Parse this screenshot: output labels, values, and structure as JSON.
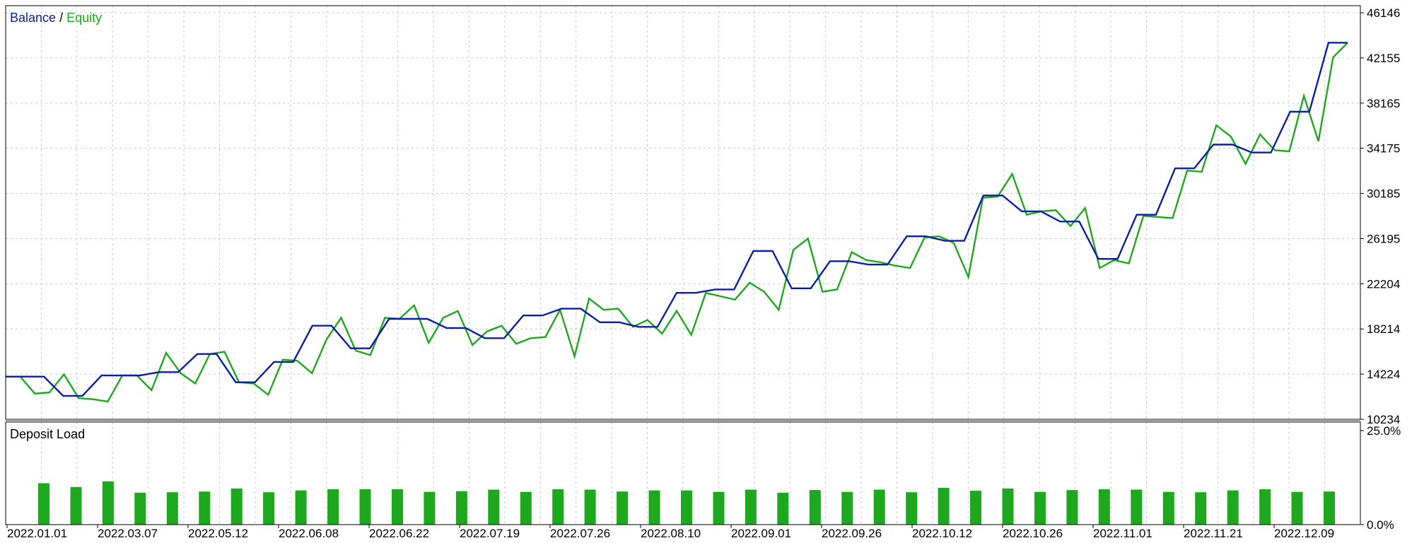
{
  "colors": {
    "balance": "#0b1fa6",
    "equity": "#1ea81e",
    "bars": "#1ea81e",
    "grid": "#c8c8c8",
    "frame": "#000000"
  },
  "legend": {
    "balance": "Balance",
    "separator": " / ",
    "equity": "Equity"
  },
  "chart_data": [
    {
      "type": "line",
      "title": "",
      "ylim": [
        10234,
        46146
      ],
      "yticks": [
        "46146",
        "42155",
        "38165",
        "34175",
        "30185",
        "26195",
        "22204",
        "18214",
        "14224",
        "10234"
      ],
      "grid": true,
      "legend_position": "top-left",
      "series": [
        {
          "name": "Balance",
          "values": [
            14000,
            14000,
            14000,
            12300,
            12300,
            14100,
            14100,
            14100,
            14400,
            14400,
            16000,
            16000,
            13500,
            13500,
            15300,
            15300,
            18500,
            18500,
            16500,
            16500,
            19100,
            19100,
            19100,
            18300,
            18300,
            17400,
            17400,
            19400,
            19400,
            20000,
            20000,
            18800,
            18800,
            18400,
            18400,
            21400,
            21400,
            21700,
            21700,
            25100,
            25100,
            21800,
            21800,
            24200,
            24200,
            23900,
            23900,
            26400,
            26400,
            26000,
            26000,
            30000,
            30000,
            28600,
            28600,
            27700,
            27700,
            24400,
            24400,
            28300,
            28300,
            32400,
            32400,
            34500,
            34500,
            33800,
            33800,
            37400,
            37400,
            43500,
            43500
          ]
        },
        {
          "name": "Equity",
          "values": [
            14000,
            14000,
            12500,
            12600,
            14200,
            12100,
            12000,
            11800,
            14100,
            14100,
            12800,
            16100,
            14300,
            13400,
            16000,
            16200,
            13500,
            13400,
            12400,
            15500,
            15400,
            14300,
            17300,
            19200,
            16300,
            15900,
            19200,
            19100,
            20300,
            17000,
            19200,
            19800,
            16800,
            18000,
            18500,
            16900,
            17400,
            17500,
            19900,
            15800,
            20900,
            19900,
            20000,
            18400,
            19000,
            17800,
            19800,
            17700,
            21400,
            21100,
            20800,
            22300,
            21500,
            19900,
            25200,
            26200,
            21500,
            21700,
            25000,
            24300,
            24100,
            23800,
            23600,
            26300,
            26400,
            25800,
            22800,
            29800,
            29900,
            31900,
            28300,
            28600,
            28700,
            27300,
            28900,
            23600,
            24300,
            24000,
            28200,
            28100,
            28000,
            32200,
            32100,
            36200,
            35200,
            32800,
            35400,
            34000,
            33900,
            38800,
            34800,
            42200,
            43500
          ]
        }
      ]
    },
    {
      "type": "bar",
      "title": "Deposit Load",
      "ylim": [
        0,
        25.0
      ],
      "yticks": [
        "25.0%",
        "0.0%"
      ],
      "categories": [
        "2022.01.01",
        "2022.03.07",
        "2022.05.12",
        "2022.06.08",
        "2022.06.22",
        "2022.07.19",
        "2022.07.26",
        "2022.08.10",
        "2022.09.01",
        "2022.09.26",
        "2022.10.12",
        "2022.10.26",
        "2022.11.01",
        "2022.11.21",
        "2022.12.09"
      ],
      "values": [
        11.0,
        10.0,
        11.5,
        8.5,
        8.6,
        8.8,
        9.6,
        8.6,
        9.1,
        9.4,
        9.4,
        9.4,
        8.7,
        8.9,
        9.3,
        8.7,
        9.4,
        9.3,
        8.8,
        9.1,
        9.1,
        8.7,
        9.3,
        8.5,
        9.2,
        8.7,
        9.3,
        8.6,
        9.8,
        9.0,
        9.6,
        8.7,
        9.2,
        9.4,
        9.3,
        8.7,
        8.6,
        9.1,
        9.4,
        8.7,
        8.8
      ]
    }
  ]
}
